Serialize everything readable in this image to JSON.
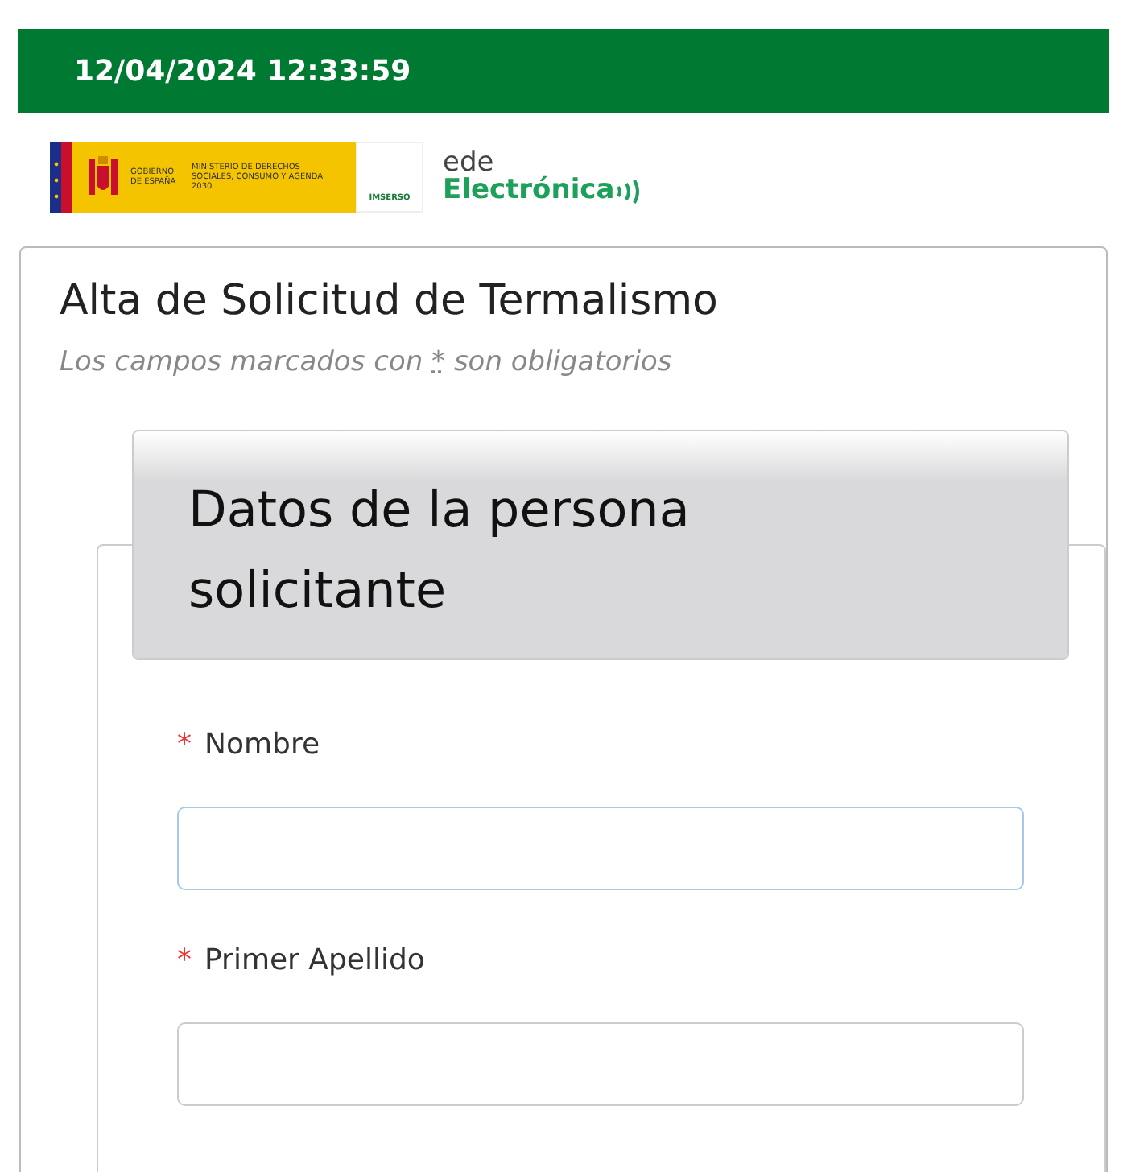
{
  "header": {
    "datetime": "12/04/2024 12:33:59"
  },
  "logos": {
    "government": "GOBIERNO DE ESPAÑA",
    "ministry": "MINISTERIO DE DERECHOS SOCIALES, CONSUMO Y AGENDA 2030",
    "agency": "IMSERSO",
    "sede_top": "ede",
    "sede_bottom": "Electrónica"
  },
  "form": {
    "title": "Alta de Solicitud de Termalismo",
    "note_before": "Los campos marcados con",
    "note_mark": "*",
    "note_after": "son obligatorios",
    "section": {
      "legend": "Datos de la persona solicitante",
      "fields": [
        {
          "label": "Nombre",
          "required": true,
          "mark": "*"
        },
        {
          "label": "Primer Apellido",
          "required": true,
          "mark": "*"
        }
      ]
    }
  }
}
